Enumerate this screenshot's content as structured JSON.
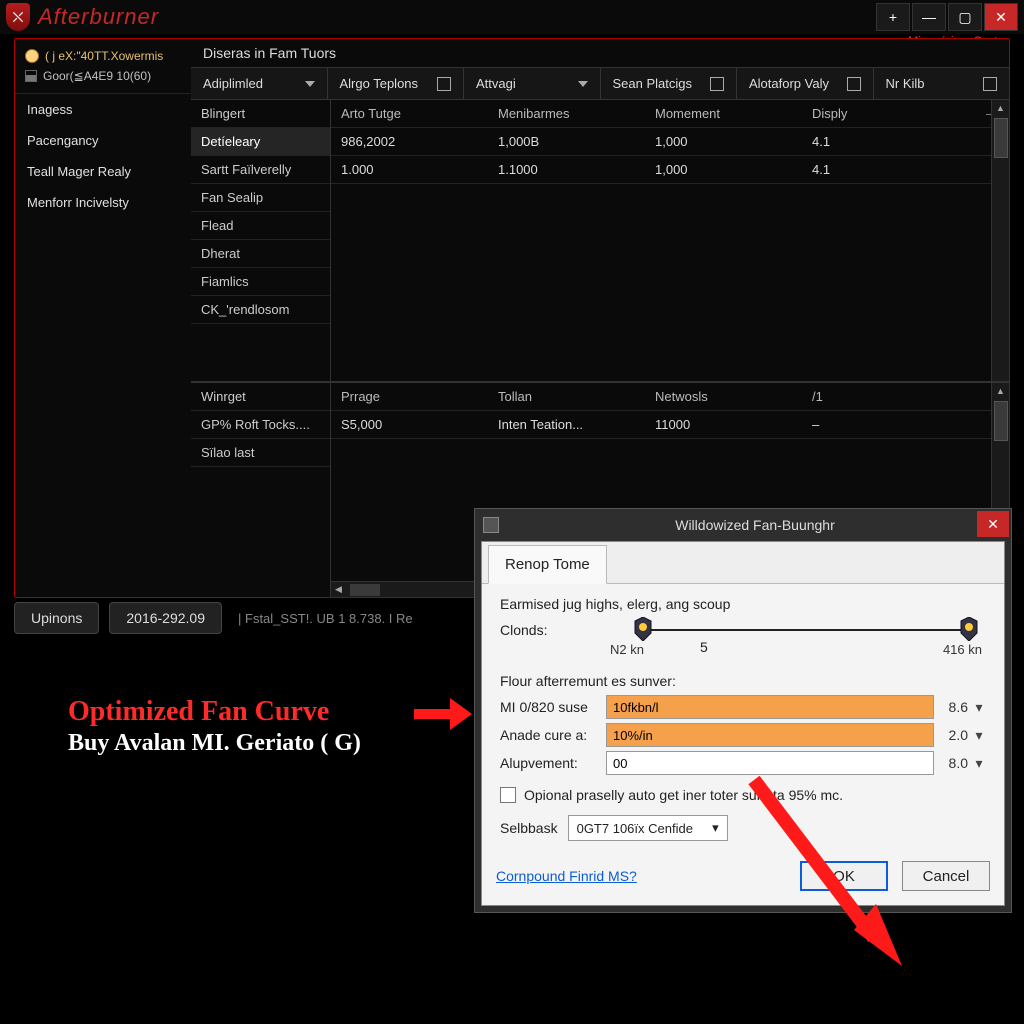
{
  "brand": "Afterburner",
  "subhead": "+Mimgríciam Cystəu",
  "window_buttons": {
    "min": "—",
    "max": "▢",
    "close": "✕",
    "plus": "+"
  },
  "sidebar": {
    "userline": "( j eX:\"40TT.Xowermis",
    "statline": "Goor(≦A4E9 10(60)",
    "items": [
      {
        "label": "Inagess"
      },
      {
        "label": "Pacengancy"
      },
      {
        "label": "Teall Mager Realy"
      },
      {
        "label": "Menforr Incivelsty"
      }
    ]
  },
  "content": {
    "title": "Diseras in Fam Tuors",
    "tabs": [
      {
        "label": "Adiplimled",
        "caret": true
      },
      {
        "label": "Alrgo Teplons",
        "icon": true
      },
      {
        "label": "Attvagi",
        "caret": true
      },
      {
        "label": "Sean Platcigs",
        "icon": true
      },
      {
        "label": "Alotaforp Valy",
        "icon": true
      },
      {
        "label": "Nr Kilb",
        "icon": true
      }
    ],
    "row_labels": [
      "Blingert",
      "Detíeleary",
      "Sartt Faïlverelly",
      "Fan Sealip",
      "Flead",
      "Dherat",
      "Fiamlics",
      "CK_'rendlosom"
    ],
    "grid_header": [
      "Arto Tutge",
      "Menibarmes",
      "Momement",
      "Disply",
      "—"
    ],
    "grid_rows": [
      [
        "986,2002",
        "1,000B",
        "1,000",
        "4.1",
        "–"
      ],
      [
        "1.000",
        "1.1000",
        "1,000",
        "4.1",
        "–"
      ]
    ],
    "lower_labels": [
      "Winrget",
      "GP% Roft Tocks....",
      "Sïlao last"
    ],
    "lower_header": [
      "Prrage",
      "Tollan",
      "Netwosls",
      "/1",
      ""
    ],
    "lower_row": [
      "S5,000",
      "Inten Teation...",
      "11000",
      "–",
      "–"
    ]
  },
  "status": {
    "btn1": "Upinons",
    "btn2": "2016-292.09",
    "text": "| Fstal_SST!. UB 1 8.738. I Re"
  },
  "annotation": {
    "line1": "Optimized Fan Curve",
    "line2": "Buy Avalan MI. Geriato ( G)"
  },
  "dialog": {
    "title": "Willdowized Fan-Buunghr",
    "tab": "Renop Tome",
    "desc": "Earmised jug highs, elerg, ang scoup",
    "slider_label": "Clonds:",
    "slider_left": "N2 kn",
    "slider_mid": "5",
    "slider_right": "416 kn",
    "group": "Flour afterremunt es sunver:",
    "fields": [
      {
        "label": "MI 0/820 suse",
        "value": "10fkbn/l",
        "right": "8.6",
        "orange": true
      },
      {
        "label": "Anade cure a:",
        "value": "10%/in",
        "right": "2.0",
        "orange": true
      },
      {
        "label": "Alupvement:",
        "value": "00",
        "right": "8.0",
        "orange": false
      }
    ],
    "checkbox": "Opional praselly auto get iner toter sure ta 95% mc.",
    "select_label": "Selbbask",
    "select_value": "0GT7 106ïx Cenfide",
    "link": "Cornpound Finrid MS?",
    "ok": "OK",
    "cancel": "Cancel"
  }
}
